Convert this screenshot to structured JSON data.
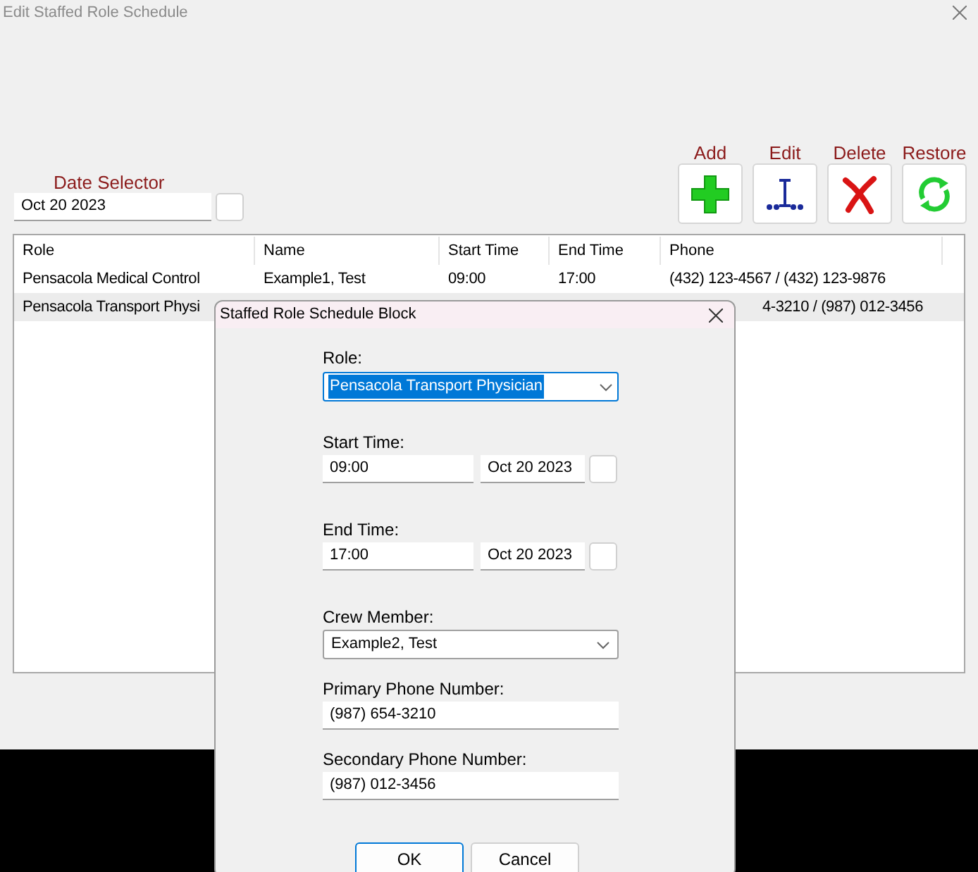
{
  "window": {
    "title": "Edit Staffed Role Schedule"
  },
  "date_selector": {
    "label": "Date Selector",
    "value": "Oct 20 2023"
  },
  "toolbar": [
    {
      "kind": "add",
      "label": "Add"
    },
    {
      "kind": "edit",
      "label": "Edit"
    },
    {
      "kind": "delete",
      "label": "Delete"
    },
    {
      "kind": "restore",
      "label": "Restore"
    }
  ],
  "table": {
    "columns": [
      "Role",
      "Name",
      "Start Time",
      "End Time",
      "Phone"
    ],
    "rows": [
      {
        "selected": false,
        "cells": [
          "Pensacola Medical Control",
          "Example1, Test",
          "09:00",
          "17:00",
          "(432) 123-4567 / (432) 123-9876"
        ]
      },
      {
        "selected": true,
        "cells": [
          "Pensacola Transport Physi",
          "",
          "",
          "",
          "4-3210 / (987) 012-3456"
        ]
      }
    ]
  },
  "dialog": {
    "title": "Staffed Role Schedule Block",
    "role": {
      "label": "Role:",
      "value": "Pensacola Transport Physician"
    },
    "start_time": {
      "label": "Start Time:",
      "time": "09:00",
      "date": "Oct 20 2023"
    },
    "end_time": {
      "label": "End Time:",
      "time": "17:00",
      "date": "Oct 20 2023"
    },
    "crew_member": {
      "label": "Crew Member:",
      "value": "Example2, Test"
    },
    "primary_phone": {
      "label": "Primary Phone Number:",
      "value": "(987) 654-3210"
    },
    "secondary_phone": {
      "label": "Secondary Phone Number:",
      "value": "(987) 012-3456"
    },
    "buttons": [
      {
        "label": "OK",
        "default": true
      },
      {
        "label": "Cancel",
        "default": false
      }
    ]
  }
}
